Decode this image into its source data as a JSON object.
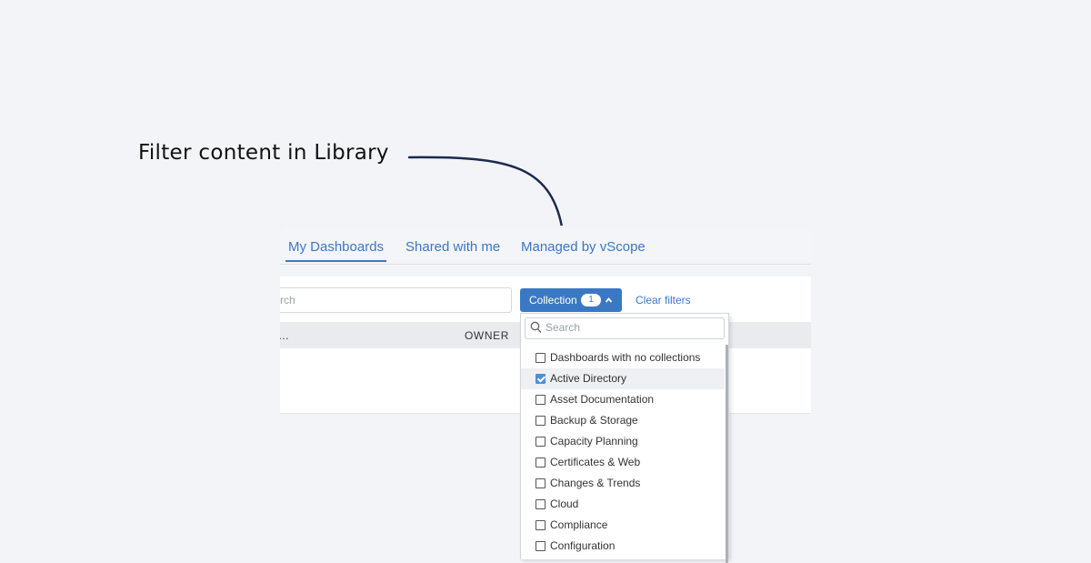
{
  "annotation": {
    "text": "Filter content in Library"
  },
  "tabs": [
    {
      "label": "My Dashboards",
      "active": true
    },
    {
      "label": "Shared with me",
      "active": false
    },
    {
      "label": "Managed by vScope",
      "active": false
    }
  ],
  "toolbar": {
    "search_fragment": "rch",
    "collection_label": "Collection",
    "collection_count": "1",
    "clear_filters_label": "Clear filters"
  },
  "table": {
    "left_fragment": "…",
    "owner_header": "OWNER"
  },
  "dropdown": {
    "search_placeholder": "Search",
    "items": [
      {
        "label": "Dashboards with no collections",
        "checked": false
      },
      {
        "label": "Active Directory",
        "checked": true
      },
      {
        "label": "Asset Documentation",
        "checked": false
      },
      {
        "label": "Backup & Storage",
        "checked": false
      },
      {
        "label": "Capacity Planning",
        "checked": false
      },
      {
        "label": "Certificates & Web",
        "checked": false
      },
      {
        "label": "Changes & Trends",
        "checked": false
      },
      {
        "label": "Cloud",
        "checked": false
      },
      {
        "label": "Compliance",
        "checked": false
      },
      {
        "label": "Configuration",
        "checked": false
      }
    ]
  },
  "colors": {
    "accent": "#3b78c4",
    "arrow": "#1a2a4f",
    "background": "#f3f4f7"
  },
  "icons": {
    "dropdown_search": "search-icon",
    "collection_toggle": "chevron-up-icon",
    "annotation_arrow": "arrow-icon"
  }
}
